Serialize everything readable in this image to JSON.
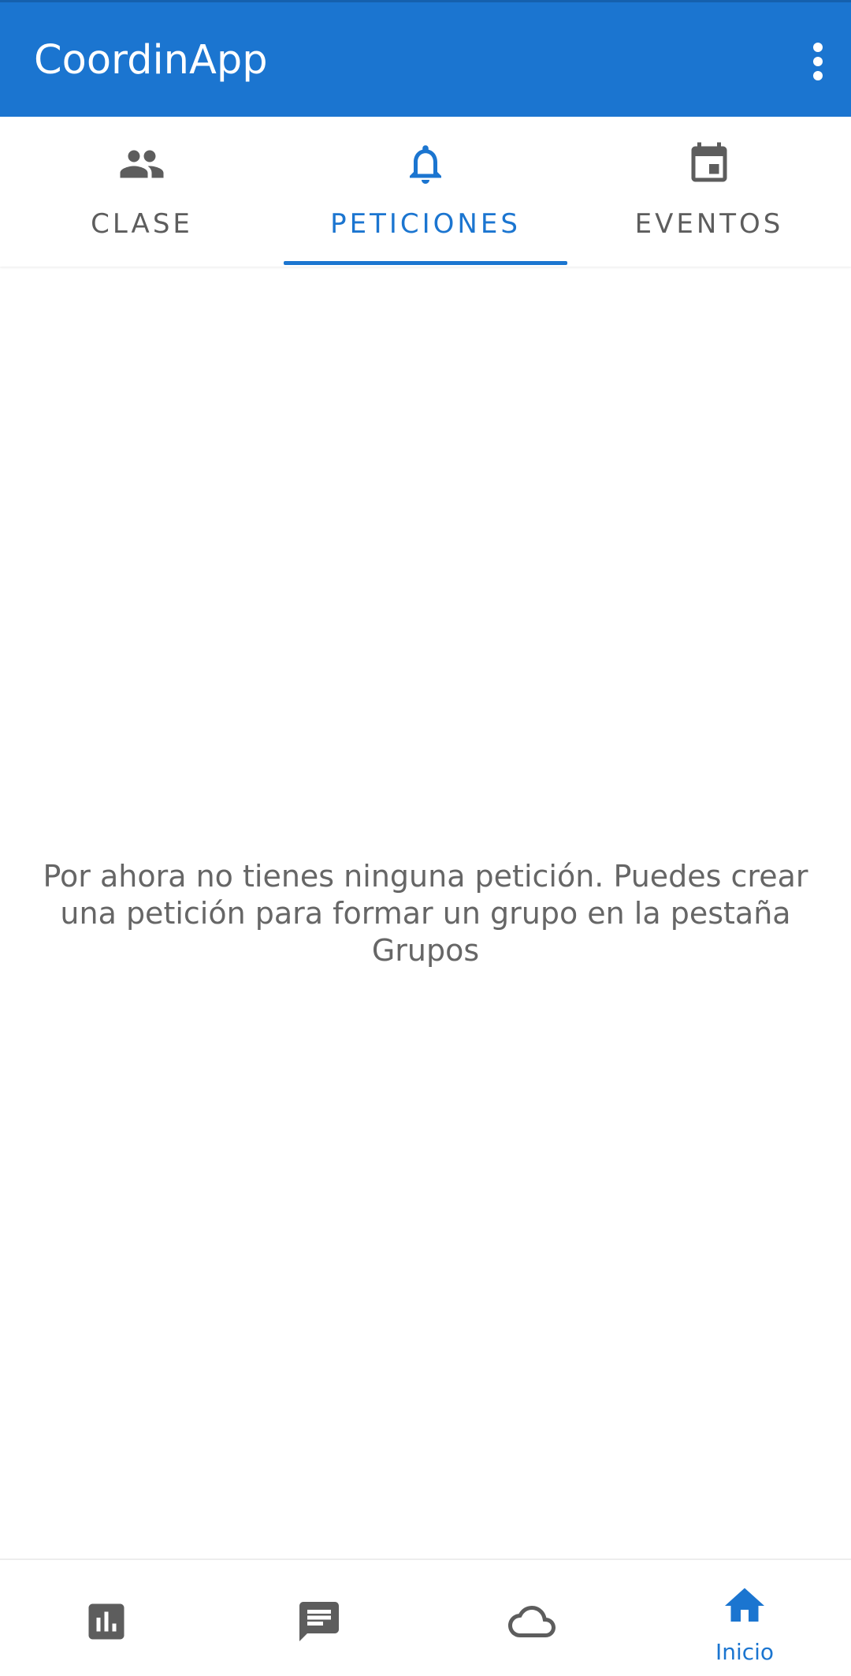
{
  "appbar": {
    "title": "CoordinApp",
    "menu_icon": "more-vert-icon"
  },
  "tabs": [
    {
      "label": "CLASE",
      "icon": "people-icon",
      "active": false
    },
    {
      "label": "PETICIONES",
      "icon": "bell-icon",
      "active": true
    },
    {
      "label": "EVENTOS",
      "icon": "calendar-icon",
      "active": false
    }
  ],
  "empty_state": {
    "message": "Por ahora no tienes ninguna petición. Puedes crear una petición para formar un grupo en la pestaña Grupos"
  },
  "bottom_nav": [
    {
      "icon": "bar-chart-icon",
      "label": "",
      "active": false
    },
    {
      "icon": "chat-icon",
      "label": "",
      "active": false
    },
    {
      "icon": "cloud-icon",
      "label": "",
      "active": false
    },
    {
      "icon": "home-icon",
      "label": "Inicio",
      "active": true
    }
  ],
  "colors": {
    "primary": "#1b75d0",
    "icon_inactive": "#5d5d5d",
    "text_secondary": "#666666"
  }
}
